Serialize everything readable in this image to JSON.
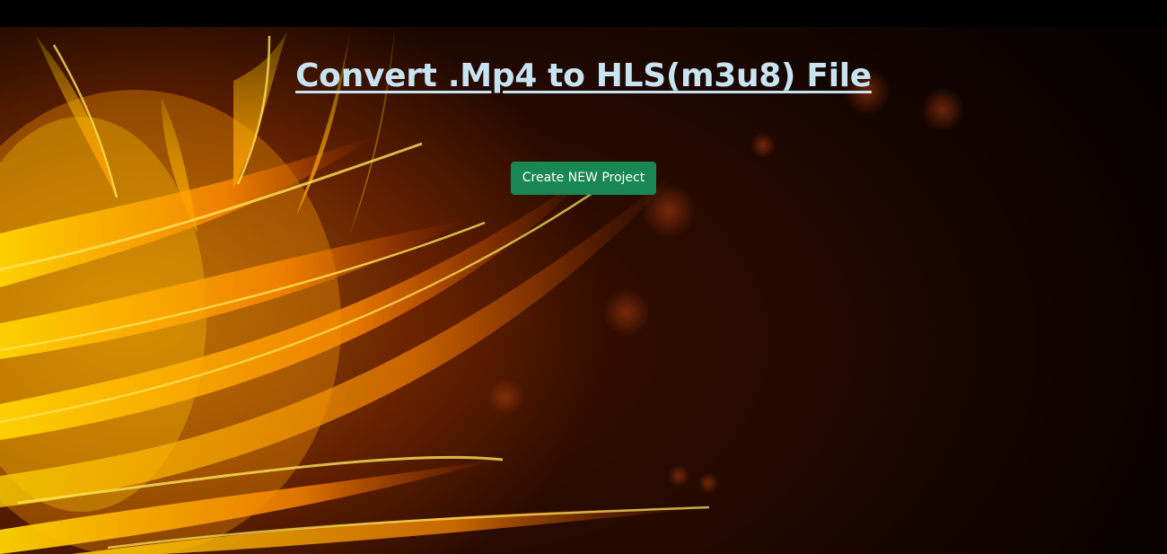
{
  "header": {
    "title": "Convert .Mp4 to HLS(m3u8) File"
  },
  "actions": {
    "create_label": "Create NEW Project"
  },
  "colors": {
    "background_top": "#000000",
    "title_link": "#c8e4f2",
    "button_bg": "#198754",
    "button_text": "#ffffff",
    "flame_bright": "#ffd400",
    "flame_mid": "#ff8a00",
    "flame_dark": "#c43a00"
  },
  "background": {
    "description_icon": "fire-flames-background"
  }
}
